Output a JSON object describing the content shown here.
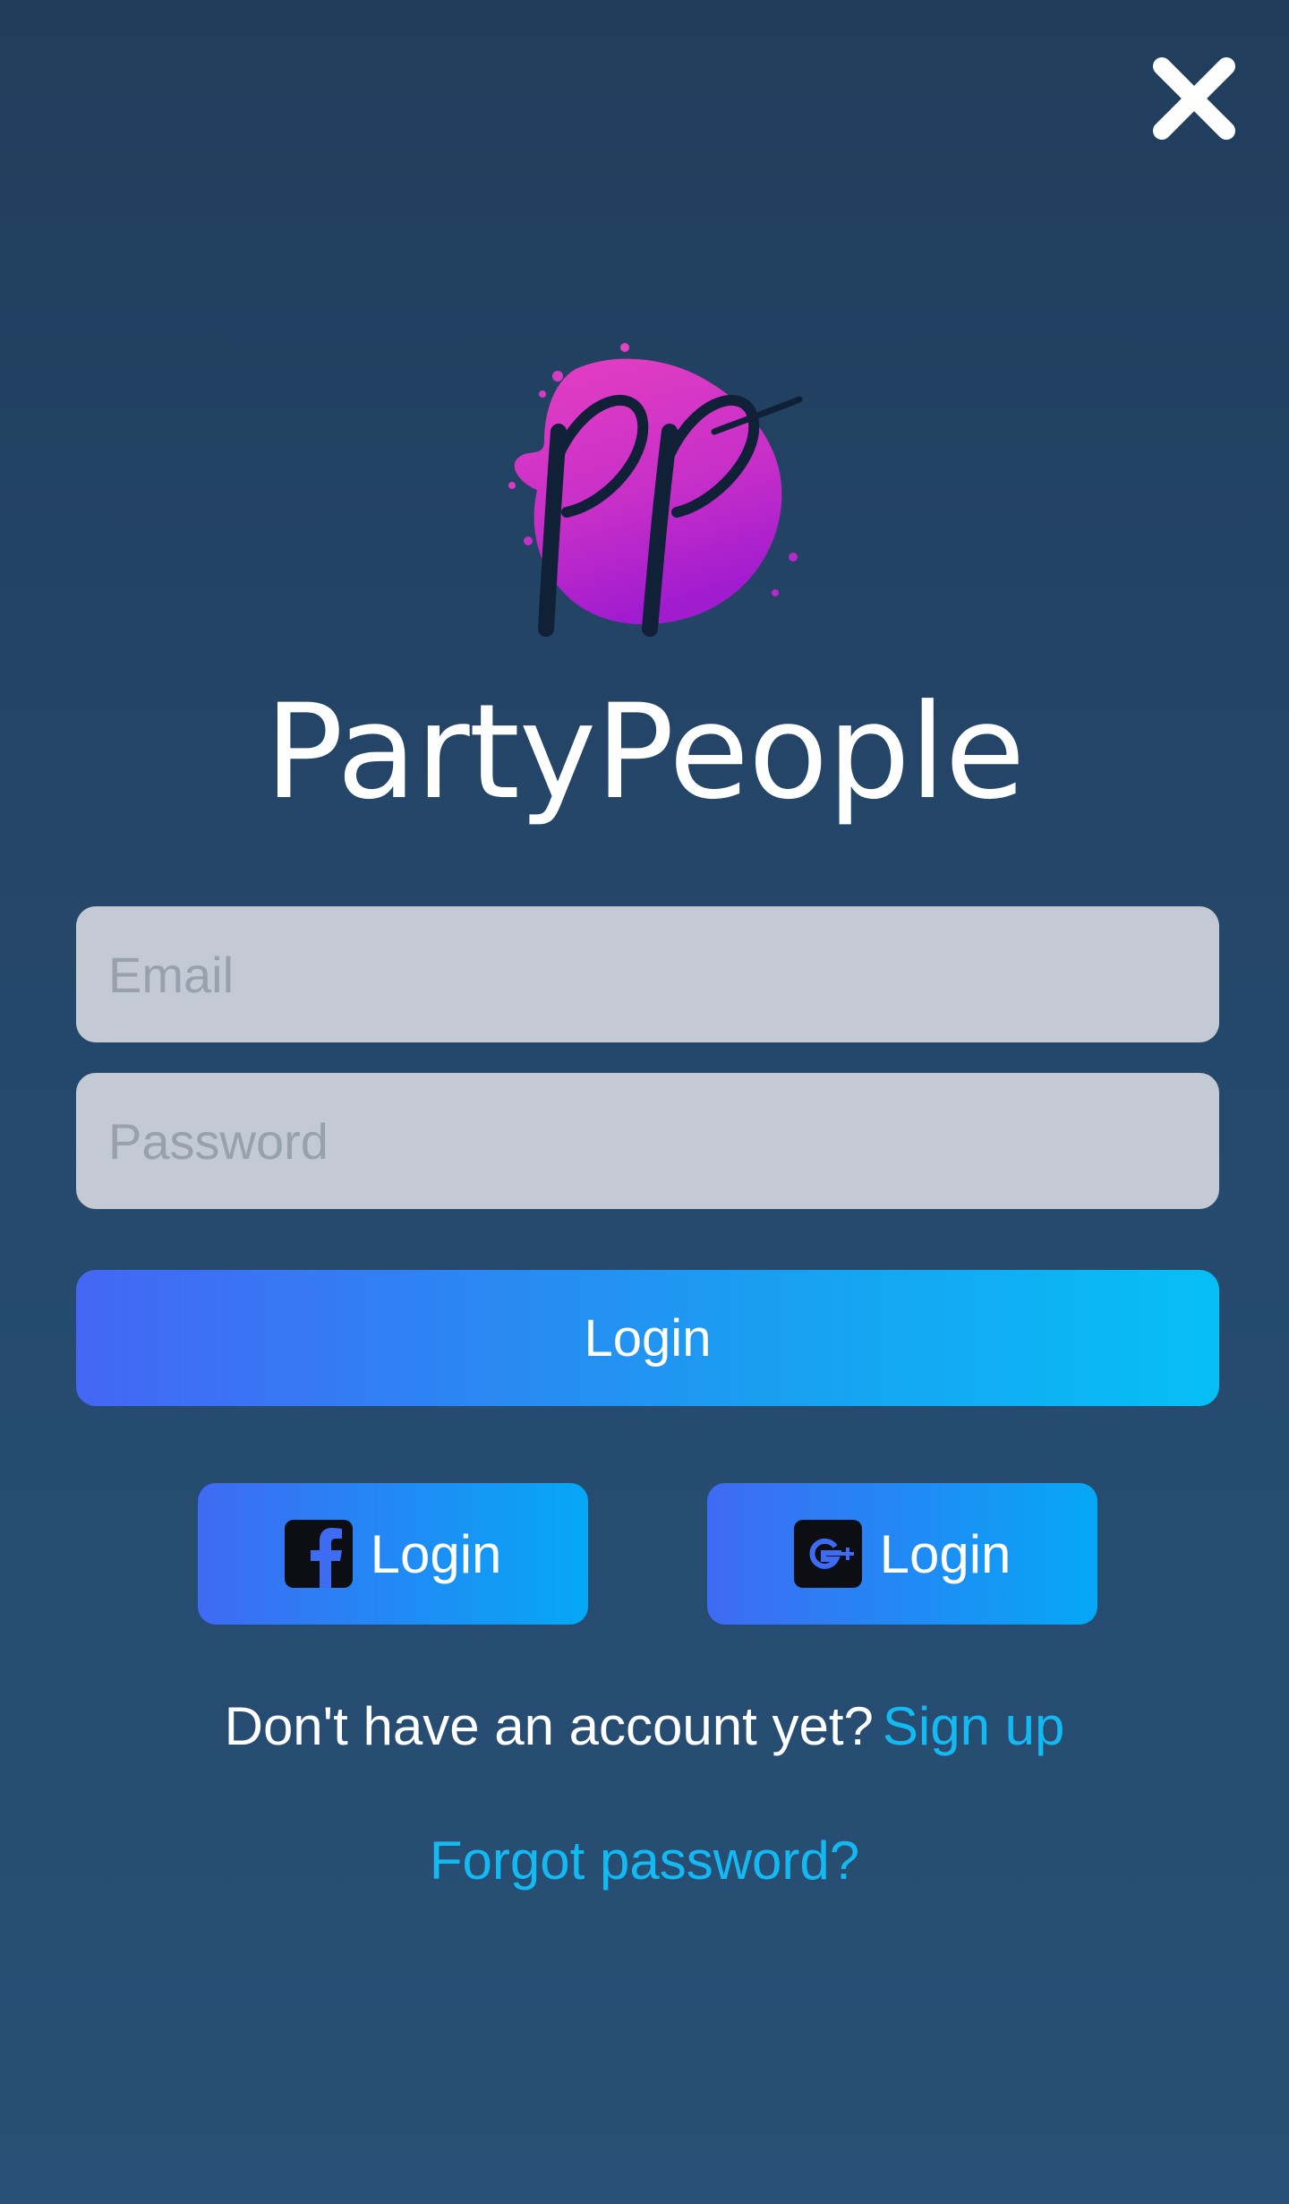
{
  "app": {
    "name": "PartyPeople",
    "logo_text": "pp"
  },
  "form": {
    "email_placeholder": "Email",
    "password_placeholder": "Password",
    "login_label": "Login"
  },
  "social": {
    "facebook_label": "Login",
    "google_label": "Login"
  },
  "footer": {
    "signup_prompt": "Don't have an account yet?",
    "signup_link": "Sign up",
    "forgot_password": "Forgot password?"
  },
  "icons": {
    "close": "close-icon",
    "facebook": "facebook-icon",
    "google": "google-plus-icon"
  },
  "colors": {
    "background": "#234466",
    "accent_link": "#14b9f2",
    "input_bg": "#c4cad3",
    "logo_splash": "#d63bc4",
    "button_gradient_start": "#4466f4",
    "button_gradient_end": "#06bff4"
  }
}
